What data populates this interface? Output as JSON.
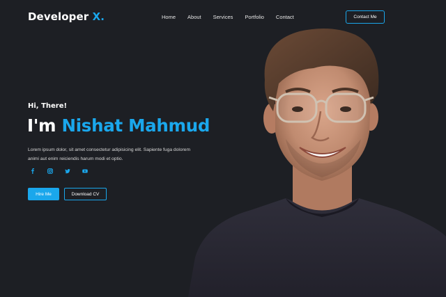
{
  "header": {
    "logo_text": "Developer",
    "logo_accent": "X.",
    "nav": [
      "Home",
      "About",
      "Services",
      "Portfolio",
      "Contact"
    ],
    "cta_label": "Contact Me"
  },
  "hero": {
    "greeting": "Hi, There!",
    "headline_prefix": "I'm",
    "headline_name": "Nishat Mahmud",
    "description": "Lorem ipsum dolor, sit amet consectetur adipisicing elit. Sapiente fuga dolorem animi aut enim reiciendis harum modi et optio.",
    "socials": [
      "facebook-icon",
      "instagram-icon",
      "twitter-icon",
      "youtube-icon"
    ],
    "primary_button": "Hire Me",
    "secondary_button": "Download CV"
  },
  "colors": {
    "background": "#1d1f24",
    "accent": "#1aa7ec",
    "text": "#ffffff"
  }
}
